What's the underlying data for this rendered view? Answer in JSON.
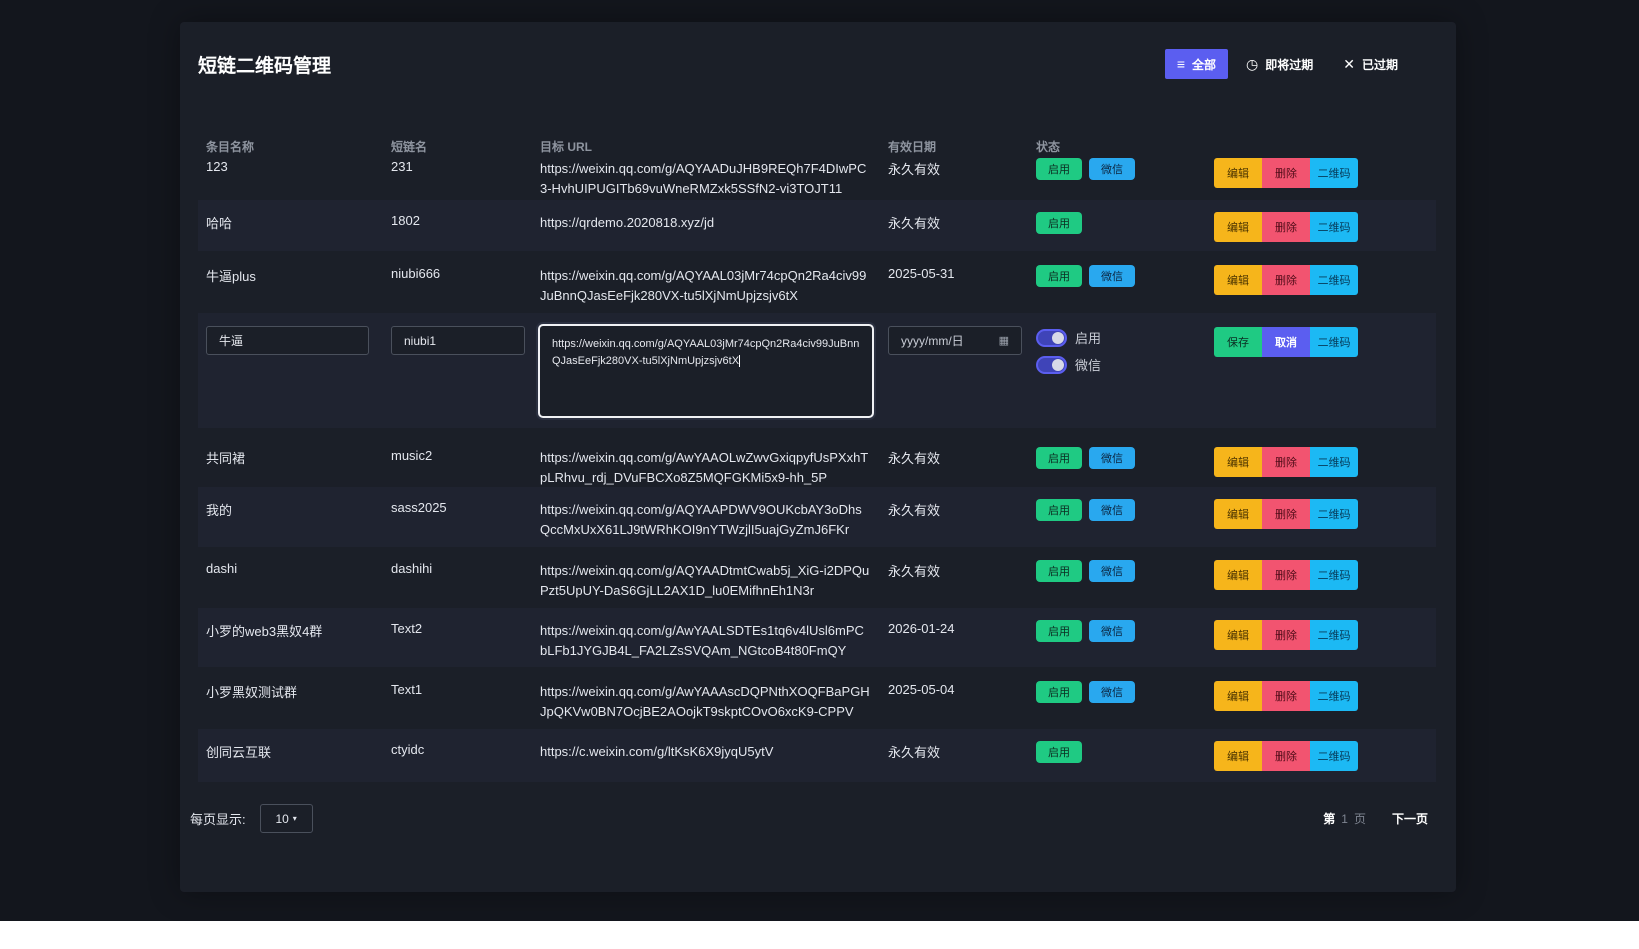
{
  "header": {
    "title": "短链二维码管理",
    "filters": [
      {
        "label": "全部",
        "icon": "list-icon"
      },
      {
        "label": "即将过期",
        "icon": "clock-icon"
      },
      {
        "label": "已过期",
        "icon": "close-icon"
      }
    ]
  },
  "table": {
    "columns": [
      "条目名称",
      "短链名",
      "目标 URL",
      "有效日期",
      "状态"
    ],
    "status_labels": {
      "enabled": "启用",
      "wechat": "微信"
    },
    "action_labels": {
      "edit": "编辑",
      "delete": "删除",
      "qrcode": "二维码",
      "save": "保存",
      "cancel": "取消"
    },
    "rows": [
      {
        "name": "123",
        "short": "231",
        "url": "https://weixin.qq.com/g/AQYAADuJHB9REQh7F4DIwPC3-HvhUIPUGITb69vuWneRMZxk5SSfN2-vi3TOJT11",
        "expiry": "永久有效",
        "wechat": true
      },
      {
        "name": "哈哈",
        "short": "1802",
        "url": "https://qrdemo.2020818.xyz/jd",
        "expiry": "永久有效",
        "wechat": false
      },
      {
        "name": "牛逼plus",
        "short": "niubi666",
        "url": "https://weixin.qq.com/g/AQYAAL03jMr74cpQn2Ra4civ99JuBnnQJasEeFjk280VX-tu5lXjNmUpjzsjv6tX",
        "expiry": "2025-05-31",
        "wechat": true
      },
      {
        "name": "共同裙",
        "short": "music2",
        "url": "https://weixin.qq.com/g/AwYAAOLwZwvGxiqpyfUsPXxhTpLRhvu_rdj_DVuFBCXo8Z5MQFGKMi5x9-hh_5P",
        "expiry": "永久有效",
        "wechat": true
      },
      {
        "name": "我的",
        "short": "sass2025",
        "url": "https://weixin.qq.com/g/AQYAAPDWV9OUKcbAY3oDhsQccMxUxX61LJ9tWRhKOI9nYTWzjlI5uajGyZmJ6FKr",
        "expiry": "永久有效",
        "wechat": true
      },
      {
        "name": "dashi",
        "short": "dashihi",
        "url": "https://weixin.qq.com/g/AQYAADtmtCwab5j_XiG-i2DPQuPzt5UpUY-DaS6GjLL2AX1D_lu0EMifhnEh1N3r",
        "expiry": "永久有效",
        "wechat": true
      },
      {
        "name": "小罗的web3黑奴4群",
        "short": "Text2",
        "url": "https://weixin.qq.com/g/AwYAALSDTEs1tq6v4lUsl6mPCbLFb1JYGJB4L_FA2LZsSVQAm_NGtcoB4t80FmQY",
        "expiry": "2026-01-24",
        "wechat": true
      },
      {
        "name": "小罗黑奴测试群",
        "short": "Text1",
        "url": "https://weixin.qq.com/g/AwYAAAscDQPNthXOQFBaPGHJpQKVw0BN7OcjBE2AOojkT9skptCOvO6xcK9-CPPV",
        "expiry": "2025-05-04",
        "wechat": true
      },
      {
        "name": "创同云互联",
        "short": "ctyidc",
        "url": "https://c.weixin.com/g/ltKsK6X9jyqU5ytV",
        "expiry": "永久有效",
        "wechat": false
      }
    ],
    "edit_row": {
      "name": "牛逼",
      "short": "niubi1",
      "url": "https://weixin.qq.com/g/AQYAAL03jMr74cpQn2Ra4civ99JuBnnQJasEeFjk280VX-tu5lXjNmUpjzsjv6tX",
      "date_placeholder": "yyyy/mm/日",
      "toggle_enabled": "启用",
      "toggle_wechat": "微信"
    }
  },
  "footer": {
    "per_page_label": "每页显示:",
    "per_page_value": "10",
    "page_prefix": "第",
    "page_number": "1",
    "page_suffix": "页",
    "next_label": "下一页"
  },
  "colors": {
    "accent": "#5b5ef0",
    "enabled": "#1fca83",
    "wechat": "#29a8ef",
    "edit": "#f6b51b",
    "delete": "#f25470",
    "qrcode": "#1cb9f4"
  }
}
